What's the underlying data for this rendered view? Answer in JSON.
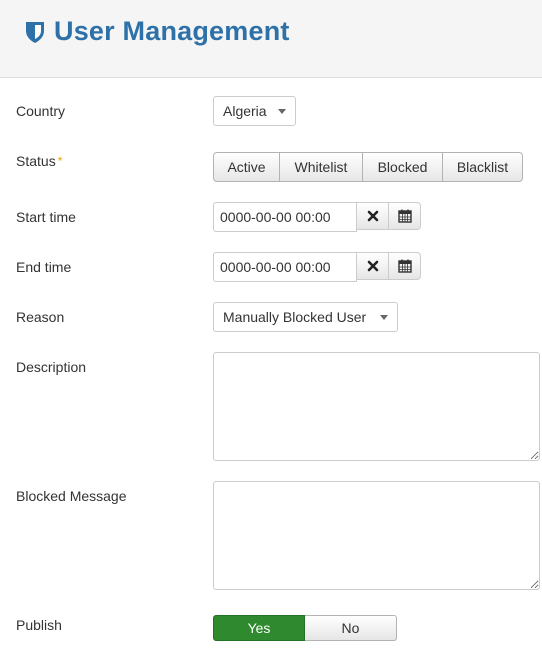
{
  "header": {
    "icon": "shield-icon",
    "title": "User Management",
    "accent_color": "#2d71a8"
  },
  "form": {
    "country": {
      "label": "Country",
      "value": "Algeria"
    },
    "status": {
      "label": "Status",
      "required_marker": "*",
      "options": [
        "Active",
        "Whitelist",
        "Blocked",
        "Blacklist"
      ]
    },
    "start_time": {
      "label": "Start time",
      "value": "0000-00-00 00:00",
      "clear_icon": "close-icon",
      "calendar_icon": "calendar-icon"
    },
    "end_time": {
      "label": "End time",
      "value": "0000-00-00 00:00",
      "clear_icon": "close-icon",
      "calendar_icon": "calendar-icon"
    },
    "reason": {
      "label": "Reason",
      "value": "Manually Blocked User"
    },
    "description": {
      "label": "Description",
      "value": ""
    },
    "blocked_message": {
      "label": "Blocked Message",
      "value": ""
    },
    "publish": {
      "label": "Publish",
      "yes_label": "Yes",
      "no_label": "No",
      "selected": "Yes",
      "selected_color": "#2f8a2f"
    }
  }
}
